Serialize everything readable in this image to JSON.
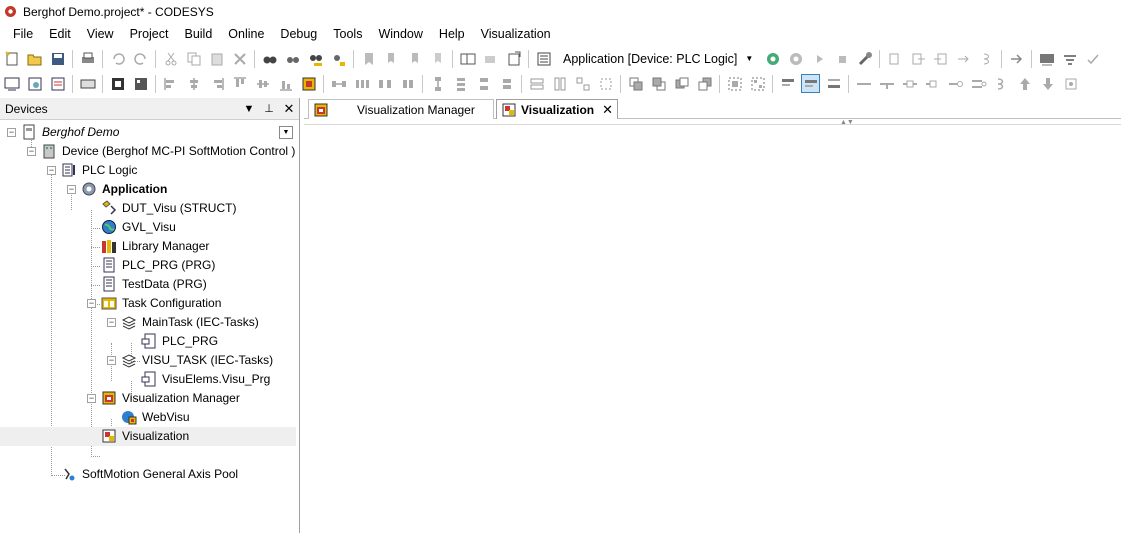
{
  "window": {
    "title": "Berghof Demo.project* - CODESYS"
  },
  "menu": [
    "File",
    "Edit",
    "View",
    "Project",
    "Build",
    "Online",
    "Debug",
    "Tools",
    "Window",
    "Help",
    "Visualization"
  ],
  "toolbar": {
    "application_selector": "Application [Device: PLC Logic]"
  },
  "devices_panel": {
    "title": "Devices",
    "tree": [
      {
        "label": "Berghof Demo",
        "icon": "project-icon"
      },
      {
        "label": "Device (Berghof MC-PI SoftMotion Control )",
        "icon": "device-icon"
      },
      {
        "label": "PLC Logic",
        "icon": "plc-logic-icon"
      },
      {
        "label": "Application",
        "icon": "application-gear-icon"
      },
      {
        "label": "DUT_Visu (STRUCT)",
        "icon": "dut-icon"
      },
      {
        "label": "GVL_Visu",
        "icon": "gvl-globe-icon"
      },
      {
        "label": "Library Manager",
        "icon": "library-books-icon"
      },
      {
        "label": "PLC_PRG (PRG)",
        "icon": "program-icon"
      },
      {
        "label": "TestData (PRG)",
        "icon": "program-icon"
      },
      {
        "label": "Task Configuration",
        "icon": "task-config-icon"
      },
      {
        "label": "MainTask (IEC-Tasks)",
        "icon": "task-icon"
      },
      {
        "label": "PLC_PRG",
        "icon": "program-call-icon"
      },
      {
        "label": "VISU_TASK (IEC-Tasks)",
        "icon": "task-icon"
      },
      {
        "label": "VisuElems.Visu_Prg",
        "icon": "program-call-icon"
      },
      {
        "label": "Visualization Manager",
        "icon": "visu-manager-icon"
      },
      {
        "label": "WebVisu",
        "icon": "webvisu-icon"
      },
      {
        "label": "Visualization",
        "icon": "visualization-icon"
      },
      {
        "label": "SoftMotion General Axis Pool",
        "icon": "axis-pool-icon"
      }
    ]
  },
  "editor": {
    "tabs": [
      {
        "label": "Visualization Manager",
        "active": false
      },
      {
        "label": "Visualization",
        "active": true
      }
    ]
  },
  "colors": {
    "selection": "#efefef",
    "accent_red": "#c0392b"
  }
}
